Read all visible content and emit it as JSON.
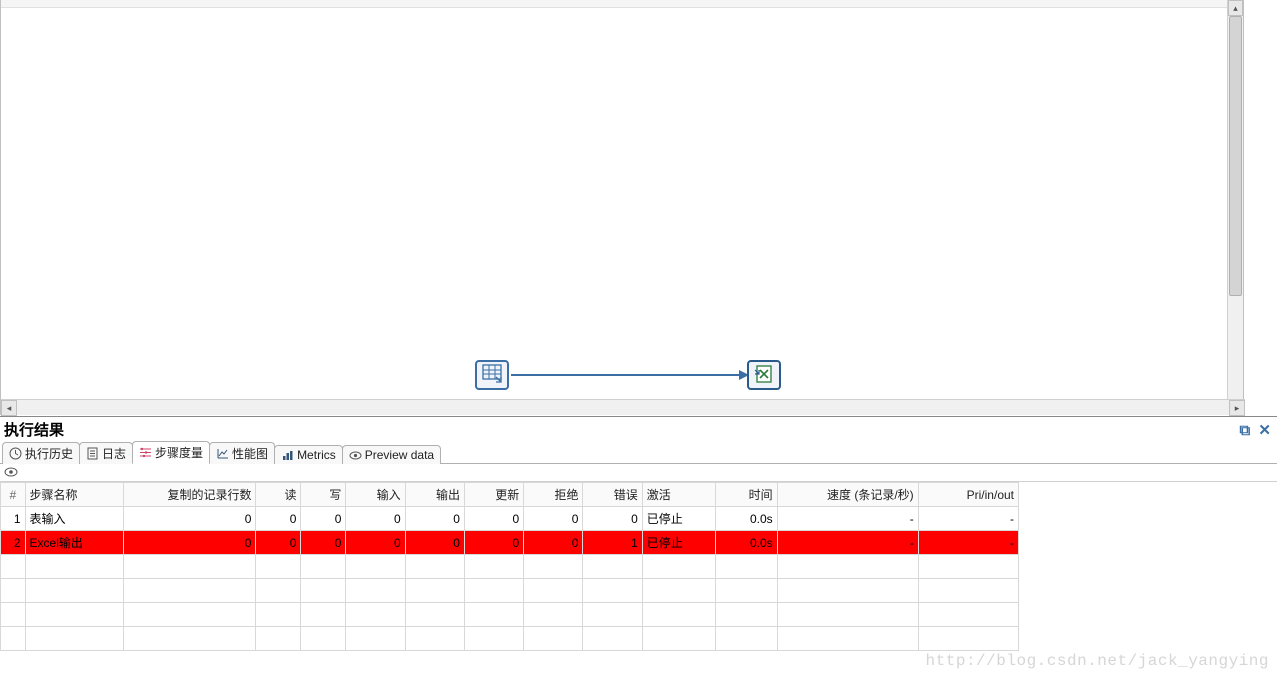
{
  "canvas": {
    "steps": [
      {
        "id": "表输入",
        "icon": "table-input-icon"
      },
      {
        "id": "Excel输出",
        "icon": "excel-output-icon"
      }
    ]
  },
  "results": {
    "title": "执行结果",
    "tabs": [
      {
        "label": "执行历史",
        "icon": "history"
      },
      {
        "label": "日志",
        "icon": "log"
      },
      {
        "label": "步骤度量",
        "icon": "metrics",
        "active": true
      },
      {
        "label": "性能图",
        "icon": "chart"
      },
      {
        "label": "Metrics",
        "icon": "metrics2"
      },
      {
        "label": "Preview data",
        "icon": "eye"
      }
    ],
    "columns": {
      "rownum": "#",
      "name": "步骤名称",
      "copy": "复制的记录行数",
      "read": "读",
      "write": "写",
      "input": "输入",
      "output": "输出",
      "update": "更新",
      "reject": "拒绝",
      "error": "错误",
      "active": "激活",
      "time": "时间",
      "speed": "速度 (条记录/秒)",
      "pri": "Pri/in/out"
    },
    "sorted_column": "reject",
    "rows": [
      {
        "n": "1",
        "name": "表输入",
        "copy": "0",
        "read": "0",
        "write": "0",
        "input": "0",
        "output": "0",
        "update": "0",
        "reject": "0",
        "error": "0",
        "active": "已停止",
        "time": "0.0s",
        "speed": "-",
        "pri": "-",
        "err": false
      },
      {
        "n": "2",
        "name": "Excel输出",
        "copy": "0",
        "read": "0",
        "write": "0",
        "input": "0",
        "output": "0",
        "update": "0",
        "reject": "0",
        "error": "1",
        "active": "已停止",
        "time": "0.0s",
        "speed": "-",
        "pri": "-",
        "err": true
      }
    ]
  },
  "watermark": "http://blog.csdn.net/jack_yangying"
}
